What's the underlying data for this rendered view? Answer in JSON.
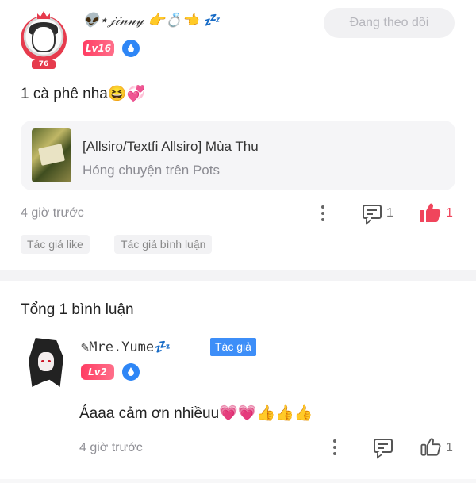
{
  "post": {
    "author_name": "👽⋆𝒿𝒾𝓃𝓃𝓎 👉💍👈 💤",
    "avatar_level_tag": "76",
    "level_badge": "Lv16",
    "follow_button": "Đang theo dõi",
    "text": "1 cà phê nha😆💞",
    "shared": {
      "title": "[Allsiro/Textfi Allsiro] Mùa Thu",
      "subtitle": "Hóng chuyện trên Pots"
    },
    "time": "4 giờ trước",
    "comment_count": "1",
    "like_count": "1",
    "tags": [
      "Tác giả like",
      "Tác giả bình luận"
    ]
  },
  "comments_section": {
    "total_label": "Tổng 1 bình luận",
    "items": [
      {
        "author_name": "✎𝙼𝚛𝚎.𝚈𝚞𝚖𝚎💤",
        "author_badge": "Tác giả",
        "level_badge": "Lv2",
        "text": "Áaaa cảm ơn nhiềuu💗💗👍👍👍",
        "time": "4 giờ trước",
        "like_count": "1"
      }
    ]
  },
  "colors": {
    "accent_red": "#ff3d63",
    "badge_blue": "#3d8ef8",
    "water_icon_blue": "#2e86f6",
    "liked_red": "#f0455c"
  },
  "icons": [
    "crown-frame-avatar",
    "water-drop-icon",
    "more-dots-icon",
    "comment-icon",
    "like-filled-icon",
    "like-outline-icon"
  ]
}
